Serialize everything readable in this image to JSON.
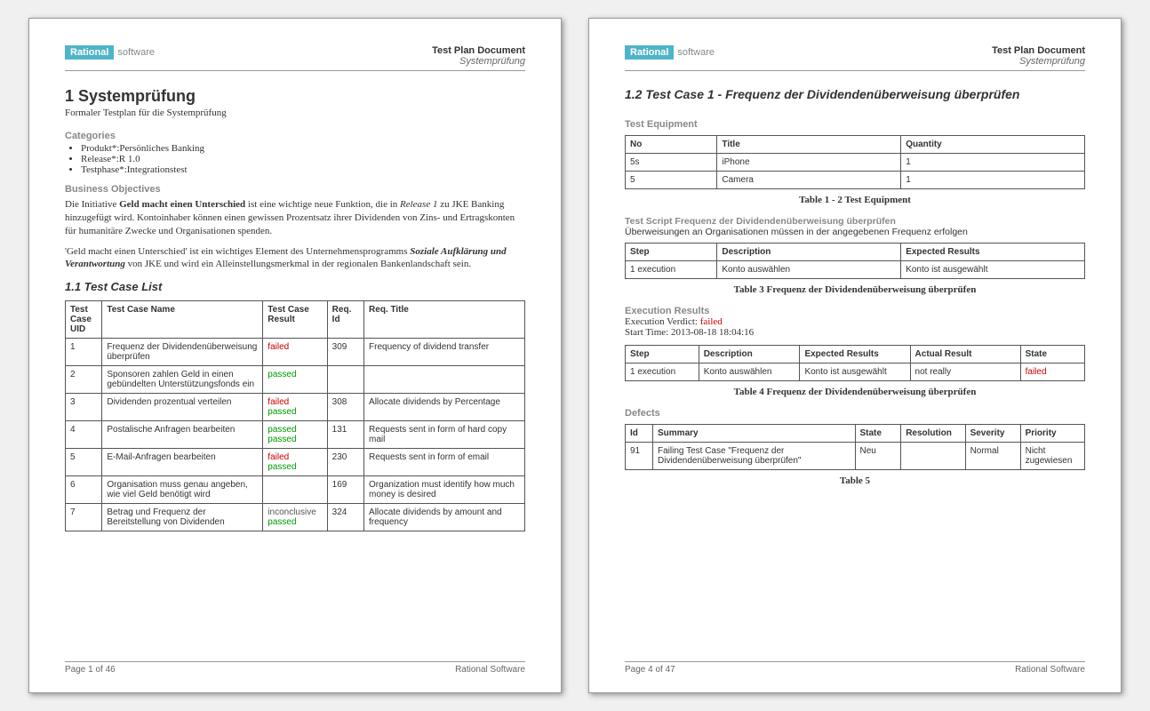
{
  "brand": {
    "rational": "Rational",
    "software": "software"
  },
  "header": {
    "doc_title": "Test Plan Document",
    "doc_sub": "Systemprüfung"
  },
  "page1": {
    "h1": "1   Systemprüfung",
    "subtitle": "Formaler Testplan für die Systemprüfung",
    "categories_label": "Categories",
    "categories": [
      "Produkt*:Persönliches Banking",
      "Release*:R 1.0",
      "Testphase*:Integrationstest"
    ],
    "bo_label": "Business Objectives",
    "bo_p1_a": "Die Initiative ",
    "bo_p1_b": "Geld macht einen Unterschied",
    "bo_p1_c": " ist eine wichtige neue Funktion, die in ",
    "bo_p1_d": "Release 1",
    "bo_p1_e": " zu JKE Banking hinzugefügt wird. Kontoinhaber können einen gewissen Prozentsatz ihrer Dividenden von Zins- und Ertragskonten für humanitäre Zwecke und Organisationen spenden.",
    "bo_p2_a": "'Geld macht einen Unterschied' ist ein wichtiges Element des Unternehmensprogramms ",
    "bo_p2_b": "Soziale Aufklärung und Verantwortung",
    "bo_p2_c": " von JKE und wird ein Alleinstellungsmerkmal in der regionalen Bankenlandschaft sein.",
    "tcl_heading": "1.1  Test Case List",
    "tcl_headers": [
      "Test Case UID",
      "Test Case Name",
      "Test Case Result",
      "Req. Id",
      "Req. Title"
    ],
    "tcl_rows": [
      {
        "uid": "1",
        "name": "Frequenz der Dividendenüberweisung überprüfen",
        "results": [
          {
            "v": "failed",
            "c": "failed"
          }
        ],
        "req": "309",
        "title": "Frequency of dividend transfer"
      },
      {
        "uid": "2",
        "name": "Sponsoren zahlen Geld in einen gebündelten Unterstützungsfonds ein",
        "results": [
          {
            "v": "passed",
            "c": "passed"
          }
        ],
        "req": "",
        "title": ""
      },
      {
        "uid": "3",
        "name": "Dividenden prozentual verteilen",
        "results": [
          {
            "v": "failed",
            "c": "failed"
          },
          {
            "v": "passed",
            "c": "passed"
          }
        ],
        "req": "308",
        "title": "Allocate dividends by Percentage"
      },
      {
        "uid": "4",
        "name": "Postalische Anfragen bearbeiten",
        "results": [
          {
            "v": "passed",
            "c": "passed"
          },
          {
            "v": "passed",
            "c": "passed"
          }
        ],
        "req": "131",
        "title": "Requests sent in form of hard copy mail"
      },
      {
        "uid": "5",
        "name": "E-Mail-Anfragen bearbeiten",
        "results": [
          {
            "v": "failed",
            "c": "failed"
          },
          {
            "v": "passed",
            "c": "passed"
          }
        ],
        "req": "230",
        "title": "Requests sent in form of email"
      },
      {
        "uid": "6",
        "name": "Organisation muss genau angeben, wie viel Geld benötigt wird",
        "results": [],
        "req": "169",
        "title": "Organization must identify how much money is desired"
      },
      {
        "uid": "7",
        "name": "Betrag und Frequenz der Bereitstellung von Dividenden",
        "results": [
          {
            "v": "inconclusive",
            "c": "inconclusive"
          },
          {
            "v": "passed",
            "c": "passed"
          }
        ],
        "req": "324",
        "title": "Allocate dividends by amount and frequency"
      }
    ],
    "footer_left": "Page 1 of  46",
    "footer_right": "Rational Software"
  },
  "page2": {
    "h2": "1.2  Test Case 1 - Frequenz der Dividendenüberweisung überprüfen",
    "equip_label": "Test Equipment",
    "equip_headers": [
      "No",
      "Title",
      "Quantity"
    ],
    "equip_rows": [
      {
        "no": "5s",
        "title": "iPhone",
        "qty": "1"
      },
      {
        "no": "5",
        "title": "Camera",
        "qty": "1"
      }
    ],
    "equip_caption": "Table 1 - 2 Test Equipment",
    "script_label": "Test Script Frequenz der Dividendenüberweisung überprüfen",
    "script_desc": "Überweisungen an Organisationen müssen in der angegebenen Frequenz erfolgen",
    "script_headers": [
      "Step",
      "Description",
      "Expected Results"
    ],
    "script_rows": [
      {
        "step": "1 execution",
        "desc": "Konto auswählen",
        "exp": "Konto ist ausgewählt"
      }
    ],
    "script_caption": "Table 3 Frequenz der Dividendenüberweisung überprüfen",
    "exec_label": "Execution Results",
    "exec_verdict_label": "Execution Verdict: ",
    "exec_verdict": "failed",
    "exec_start_label": "Start Time: ",
    "exec_start": "2013-08-18 18:04:16",
    "exec_headers": [
      "Step",
      "Description",
      "Expected Results",
      "Actual Result",
      "State"
    ],
    "exec_rows": [
      {
        "step": "1 execution",
        "desc": "Konto auswählen",
        "exp": "Konto ist ausgewählt",
        "act": "not really",
        "state": "failed",
        "state_c": "failed"
      }
    ],
    "exec_caption": "Table 4 Frequenz der Dividendenüberweisung überprüfen",
    "defects_label": "Defects",
    "defects_headers": [
      "Id",
      "Summary",
      "State",
      "Resolution",
      "Severity",
      "Priority"
    ],
    "defects_rows": [
      {
        "id": "91",
        "summary": "Failing Test Case \"Frequenz der Dividendenüberweisung überprüfen\"",
        "state": "Neu",
        "res": "",
        "sev": "Normal",
        "prio": "Nicht zugewiesen"
      }
    ],
    "defects_caption": "Table 5",
    "footer_left": "Page 4 of  47",
    "footer_right": "Rational Software"
  }
}
